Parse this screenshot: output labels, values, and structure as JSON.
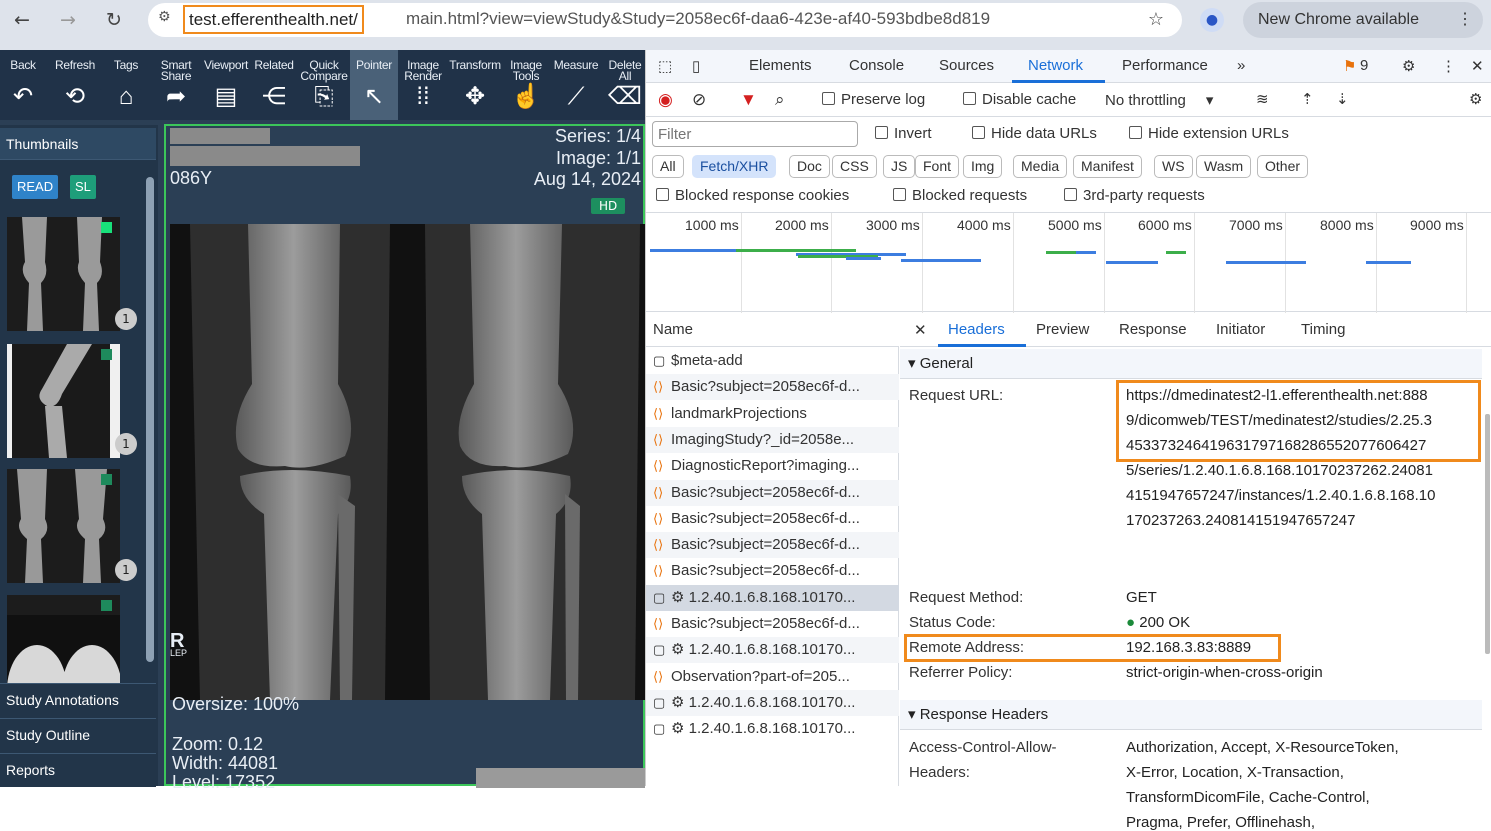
{
  "browser": {
    "url_host": "test.efferenthealth.net/",
    "url_rest": "main.html?view=viewStudy&Study=2058ec6f-daa6-423e-af40-593bdbe8d819",
    "update_label": "New Chrome available"
  },
  "viewer": {
    "tools": [
      {
        "label": "Back",
        "icon": "↶"
      },
      {
        "label": "Refresh",
        "icon": "⟲"
      },
      {
        "label": "Tags",
        "icon": "⌂"
      },
      {
        "label": "Smart Share",
        "icon": "➦"
      },
      {
        "label": "Viewport",
        "icon": "▤"
      },
      {
        "label": "Related",
        "icon": "⋲"
      },
      {
        "label": "Quick Compare",
        "icon": "⎘"
      },
      {
        "label": "Pointer",
        "icon": "↖"
      },
      {
        "label": "Image Render",
        "icon": "⁞⁞"
      },
      {
        "label": "Transform",
        "icon": "✥"
      },
      {
        "label": "Image Tools",
        "icon": "☝"
      },
      {
        "label": "Measure",
        "icon": "⟋"
      },
      {
        "label": "Delete All",
        "icon": "⌫"
      }
    ],
    "thumbnails_label": "Thumbnails",
    "read_badge": "READ",
    "sl_badge": "SL",
    "thumb_counts": [
      "1",
      "1",
      "1"
    ],
    "panel_rows": [
      "Study Annotations",
      "Study Outline",
      "Reports"
    ],
    "overlay": {
      "series": "Series: 1/4",
      "image": "Image: 1/1",
      "date": "Aug 14, 2024",
      "age": "086Y",
      "hd": "HD",
      "marker": "R",
      "marker_sub": "LEP",
      "oversize": "Oversize: 100%",
      "zoom": "Zoom: 0.12",
      "width": "Width: 44081",
      "level": "Level: 17352"
    }
  },
  "devtools": {
    "tabs": [
      "Elements",
      "Console",
      "Sources",
      "Network",
      "Performance"
    ],
    "issues_count": "9",
    "toolbar": {
      "preserve_log": "Preserve log",
      "disable_cache": "Disable cache",
      "throttling": "No throttling"
    },
    "filter": {
      "placeholder": "Filter",
      "invert": "Invert",
      "hide_data_urls": "Hide data URLs",
      "hide_extension_urls": "Hide extension URLs"
    },
    "type_chips": [
      "All",
      "Fetch/XHR",
      "Doc",
      "CSS",
      "JS",
      "Font",
      "Img",
      "Media",
      "Manifest",
      "WS",
      "Wasm",
      "Other"
    ],
    "blocked": {
      "cookies": "Blocked response cookies",
      "requests": "Blocked requests",
      "third_party": "3rd-party requests"
    },
    "timeline_labels": [
      "1000 ms",
      "2000 ms",
      "3000 ms",
      "4000 ms",
      "5000 ms",
      "6000 ms",
      "7000 ms",
      "8000 ms",
      "9000 ms"
    ],
    "name_header": "Name",
    "requests": [
      {
        "type": "doc",
        "name": "$meta-add"
      },
      {
        "type": "fetch",
        "name": "Basic?subject=2058ec6f-d..."
      },
      {
        "type": "fetch",
        "name": "landmarkProjections"
      },
      {
        "type": "fetch",
        "name": "ImagingStudy?_id=2058e..."
      },
      {
        "type": "fetch",
        "name": "DiagnosticReport?imaging..."
      },
      {
        "type": "fetch",
        "name": "Basic?subject=2058ec6f-d..."
      },
      {
        "type": "fetch",
        "name": "Basic?subject=2058ec6f-d..."
      },
      {
        "type": "fetch",
        "name": "Basic?subject=2058ec6f-d..."
      },
      {
        "type": "fetch",
        "name": "Basic?subject=2058ec6f-d..."
      },
      {
        "type": "doc",
        "name": "⚙ 1.2.40.1.6.8.168.10170..."
      },
      {
        "type": "fetch",
        "name": "Basic?subject=2058ec6f-d..."
      },
      {
        "type": "doc",
        "name": "⚙ 1.2.40.1.6.8.168.10170..."
      },
      {
        "type": "fetch",
        "name": "Observation?part-of=205..."
      },
      {
        "type": "doc",
        "name": "⚙ 1.2.40.1.6.8.168.10170..."
      },
      {
        "type": "doc",
        "name": "⚙ 1.2.40.1.6.8.168.10170..."
      }
    ],
    "detail_tabs": [
      "Headers",
      "Preview",
      "Response",
      "Initiator",
      "Timing"
    ],
    "general_label": "▾ General",
    "general": {
      "request_url_key": "Request URL:",
      "request_url_lines": [
        "https://dmedinatest2-l1.efferenthealth.net:888",
        "9/dicomweb/TEST/medinatest2/studies/2.25.3",
        "45337324641963179716828655207760642​7",
        "5/series/1.2.40.1.6.8.168.10170237262.24081",
        "4151947657247/instances/1.2.40.1.6.8.168.10",
        "170237263.240814151947657247"
      ],
      "method_key": "Request Method:",
      "method": "GET",
      "status_key": "Status Code:",
      "status": "200 OK",
      "remote_key": "Remote Address:",
      "remote": "192.168.3.83:8889",
      "referrer_key": "Referrer Policy:",
      "referrer": "strict-origin-when-cross-origin"
    },
    "response_headers_label": "▾ Response Headers",
    "acah_key_1": "Access-Control-Allow-",
    "acah_key_2": "Headers:",
    "acah_values": [
      "Authorization, Accept, X-ResourceToken,",
      "X-Error, Location, X-Transaction,",
      "TransformDicomFile, Cache-Control,",
      "Pragma, Prefer, Offlinehash,"
    ]
  }
}
